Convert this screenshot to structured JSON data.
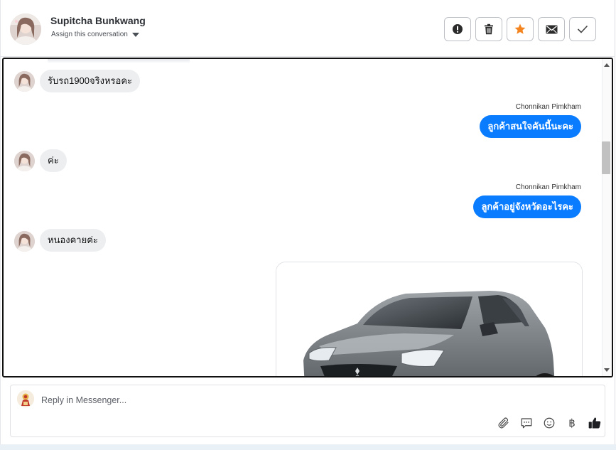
{
  "header": {
    "contact_name": "Supitcha Bunkwang",
    "assign_label": "Assign this conversation",
    "actions": [
      {
        "name": "mark-spam-button",
        "icon": "exclamation-icon"
      },
      {
        "name": "delete-button",
        "icon": "trash-icon"
      },
      {
        "name": "star-button",
        "icon": "star-icon",
        "color": "#f4841f"
      },
      {
        "name": "mark-unread-button",
        "icon": "envelope-icon"
      },
      {
        "name": "mark-done-button",
        "icon": "checkmark-icon"
      }
    ]
  },
  "messages": [
    {
      "direction": "incoming",
      "text": "รับรถ1900จริงหรอคะ"
    },
    {
      "direction": "outgoing",
      "sender": "Chonnikan Pimkham",
      "text": "ลูกค้าสนใจคันนี้นะคะ"
    },
    {
      "direction": "incoming",
      "text": "ค่ะ"
    },
    {
      "direction": "outgoing",
      "sender": "Chonnikan Pimkham",
      "text": "ลูกค้าอยู่จังหวัดอะไรคะ"
    },
    {
      "direction": "incoming",
      "text": "หนองคายค่ะ"
    },
    {
      "direction": "outgoing",
      "type": "image",
      "image": "car-photo"
    }
  ],
  "composer": {
    "placeholder": "Reply in Messenger...",
    "tools": [
      "paperclip-icon",
      "saved-reply-icon",
      "emoji-icon",
      "baht-icon",
      "thumbs-up-icon"
    ],
    "baht_symbol": "฿"
  },
  "colors": {
    "outgoing_bubble": "#0a7cff",
    "incoming_bubble": "#eceef0",
    "star": "#f4841f"
  }
}
